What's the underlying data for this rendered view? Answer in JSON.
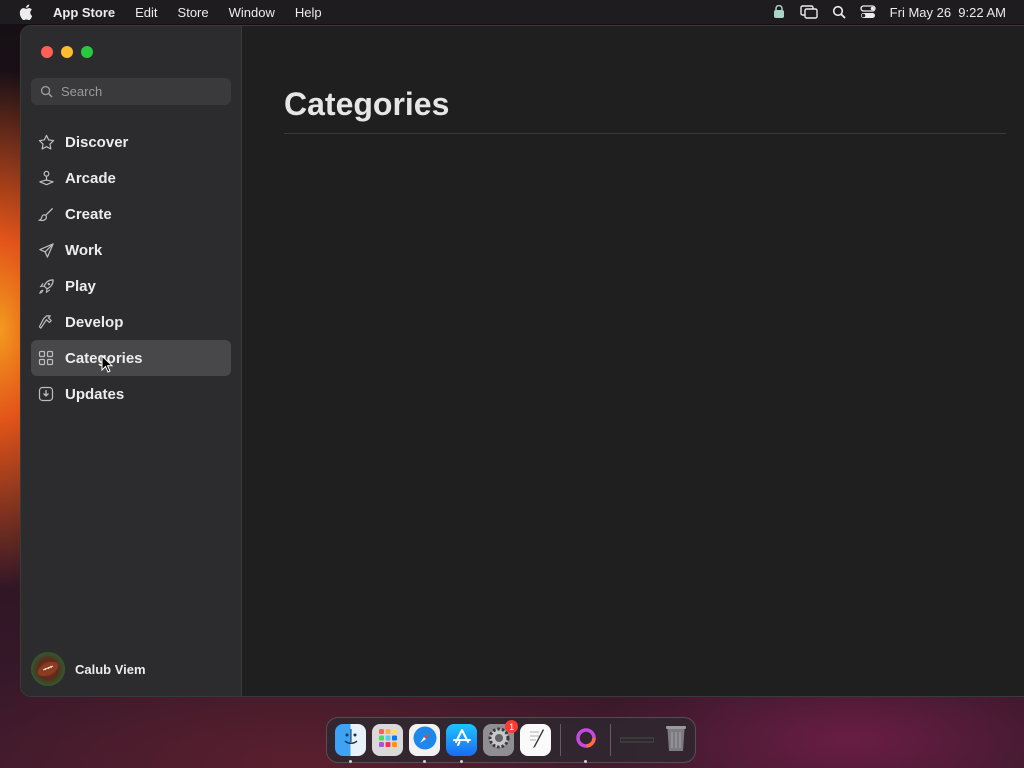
{
  "menubar": {
    "app_name": "App Store",
    "menus": [
      "Edit",
      "Store",
      "Window",
      "Help"
    ],
    "datetime": "Fri May 26  9:22 AM",
    "status_icons": [
      "vpn-status-icon",
      "screen-mirroring-icon",
      "spotlight-icon",
      "control-center-icon"
    ]
  },
  "sidebar": {
    "search_placeholder": "Search",
    "items": [
      {
        "label": "Discover",
        "icon": "star-icon"
      },
      {
        "label": "Arcade",
        "icon": "joystick-icon"
      },
      {
        "label": "Create",
        "icon": "brush-icon"
      },
      {
        "label": "Work",
        "icon": "paper-plane-icon"
      },
      {
        "label": "Play",
        "icon": "rocket-icon"
      },
      {
        "label": "Develop",
        "icon": "hammer-icon"
      },
      {
        "label": "Categories",
        "icon": "grid-icon",
        "active": true
      },
      {
        "label": "Updates",
        "icon": "download-icon"
      }
    ],
    "account_name": "Calub Viem"
  },
  "main": {
    "title": "Categories"
  },
  "dock": {
    "apps": [
      "Finder",
      "Launchpad",
      "Safari",
      "App Store",
      "System Settings",
      "TextEdit",
      "Screen Recorder",
      "Minimized Window",
      "Trash"
    ],
    "settings_badge": "1"
  },
  "colors": {
    "sidebar_bg": "#2c2c2e",
    "main_bg": "#1f1f1f",
    "active_item_bg": "#48484a",
    "close": "#ff5f57",
    "minimize": "#febc2e",
    "maximize": "#28c840"
  }
}
